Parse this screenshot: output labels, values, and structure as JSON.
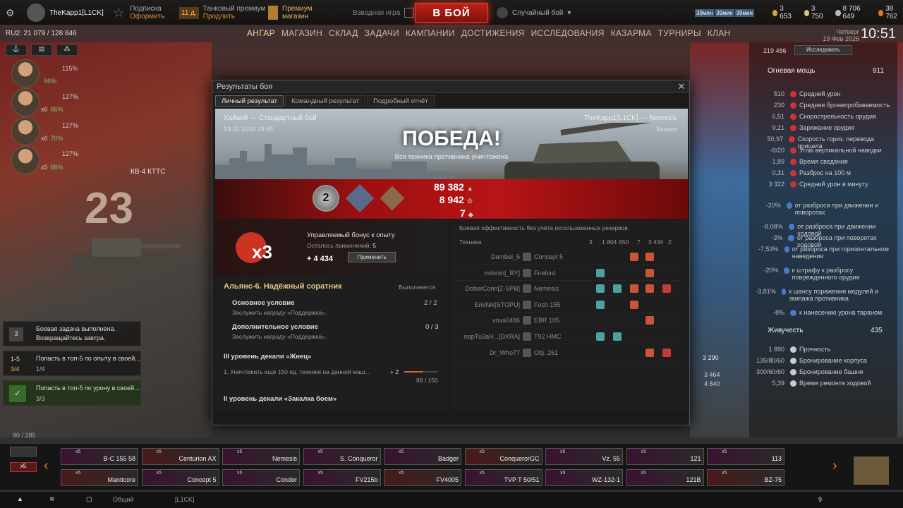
{
  "topbar": {
    "player": "TheKapp1[L1CK]",
    "sub_label": "Подписка",
    "sub_action": "Оформить",
    "prem_days": "11 д.",
    "prem_label": "Танковый премиум",
    "prem_action": "Продлить",
    "shop_line1": "Премиум",
    "shop_line2": "магазин",
    "platoon": "Взводная игра",
    "battle": "В БОЙ",
    "mode": "Случайный бой",
    "queue": [
      "39мин",
      "39мин",
      "39мин"
    ],
    "gold": "3 653",
    "bonds": "3 750",
    "credits": "8 706 649",
    "freexp": "38 762"
  },
  "nav": {
    "items": [
      "АНГАР",
      "МАГАЗИН",
      "СКЛАД",
      "ЗАДАЧИ",
      "КАМПАНИИ",
      "ДОСТИЖЕНИЯ",
      "ИССЛЕДОВАНИЯ",
      "КАЗАРМА",
      "ТУРНИРЫ",
      "КЛАН"
    ],
    "time": "10:51",
    "day": "Четверг",
    "date": "19 Фев 2026"
  },
  "ru": "RU2: 21 079  /  128 846",
  "crew": [
    {
      "mult": "",
      "pct1": "115%",
      "pct2": "66%"
    },
    {
      "mult": "x6",
      "pct1": "127%",
      "pct2": "66%"
    },
    {
      "mult": "x6",
      "pct1": "127%",
      "pct2": "70%"
    },
    {
      "mult": "x5",
      "pct1": "127%",
      "pct2": "66%"
    }
  ],
  "hangar_tank": "КВ-4 КТТС",
  "window": {
    "title": "Результаты боя",
    "tabs": [
      "Личный результат",
      "Командный результат",
      "Подробный отчёт"
    ],
    "map": "Хайвей — Стандартный бой",
    "date": "19.02.2026 10:45",
    "player": "TheKapp1[L1CK] — Nemesis",
    "survived": "Выжил",
    "victory": "ПОБЕДА!",
    "victory_sub": "Вся техника противника уничтожена",
    "credits": "89 382",
    "xp": "8 942",
    "crystals": "7",
    "mastery": "2"
  },
  "bonus": {
    "title": "Управляемый бонус к опыту",
    "remaining_label": "Осталось применений:",
    "remaining": "5",
    "xp": "+ 4 434",
    "apply": "Применить",
    "mult": "x3"
  },
  "quest": {
    "title": "Альянс-6. Надёжный соратник",
    "status": "Выполняется",
    "main_label": "Основное условие",
    "main_desc": "Заслужить награду «Поддержка».",
    "main_prog": "2 / 2",
    "extra_label": "Дополнительное условие",
    "extra_desc": "Заслужить награду «Поддержка».",
    "extra_prog": "0 / 3",
    "decal1": "III уровень декали «Жнец»",
    "decal1_task": "1. Уничтожить ещё 150 ед. техники на данной маш...",
    "decal1_plus": "+ 2",
    "decal1_prog": "86 / 150",
    "decal2": "II уровень декали «Закалка боем»"
  },
  "eff": {
    "title": "Боевая эффективность без учёта использованных резервов",
    "col_tech": "Техника",
    "cols": [
      "3",
      "1 804",
      "650",
      "7",
      "3 434",
      "2"
    ],
    "rows": [
      {
        "p": "Dembel_5",
        "v": "Concept 5"
      },
      {
        "p": "milonin[_BY]",
        "v": "Firebird"
      },
      {
        "p": "DoberConn[Z-SPB]",
        "v": "Nemesis"
      },
      {
        "p": "EmiNik[STOPU]",
        "v": "Foch 155"
      },
      {
        "p": "vova0486",
        "v": "EBR 105"
      },
      {
        "p": "napTu3aH...[DXRA]",
        "v": "T92 HMC"
      },
      {
        "p": "Dr_Who77",
        "v": "Obj. 261"
      }
    ]
  },
  "right": {
    "research_xp": "219 486",
    "research": "Исследовать",
    "firepower": "Огневая мощь",
    "firepower_val": "911",
    "fp_rows": [
      {
        "n": "510",
        "t": "Средний урон"
      },
      {
        "n": "230",
        "t": "Средняя бронепробиваемость"
      },
      {
        "n": "6,51",
        "t": "Скорострельность орудия"
      },
      {
        "n": "9,21",
        "t": "Заряжание орудия"
      },
      {
        "n": "50,97",
        "t": "Скорость гориз. перевода прицела"
      },
      {
        "n": "-8/20",
        "t": "Углы вертикальной наводки"
      },
      {
        "n": "1,89",
        "t": "Время сведения"
      },
      {
        "n": "0,31",
        "t": "Разброс на 100 м"
      },
      {
        "n": "3 322",
        "t": "Средний урон в минуту"
      }
    ],
    "disp_rows": [
      {
        "n": "-20%",
        "t": "от разброса при движении и поворотах"
      },
      {
        "n": "-8,08%",
        "t": "от разброса при движении ходовой"
      },
      {
        "n": "-3%",
        "t": "от разброса при поворотах ходовой"
      },
      {
        "n": "-7,53%",
        "t": "от разброса при горизонтальном наведении"
      },
      {
        "n": "-20%",
        "t": "к штрафу к разбросу поврежденного орудия"
      },
      {
        "n": "-3,81%",
        "t": "к шансу поражения модулей и экипажа противника"
      },
      {
        "n": "-8%",
        "t": "к нанесению урона тараном"
      }
    ],
    "surv": "Живучесть",
    "surv_val": "435",
    "sv_rows": [
      {
        "n": "1 890",
        "t": "Прочность"
      },
      {
        "n": "135/80/60",
        "t": "Бронирование корпуса"
      },
      {
        "n": "300/60/60",
        "t": "Бронирование башни"
      },
      {
        "n": "5,39",
        "t": "Время ремонта ходовой"
      }
    ],
    "side_nums": [
      "3 290",
      "3 464",
      "4 840"
    ]
  },
  "left_quests": [
    {
      "title": "Боевая задача выполнена.",
      "sub": "Возвращайтесь завтра."
    },
    {
      "title": "Попасть в топ-5 по опыту в своей...",
      "prog": "1/4",
      "left": "1-5",
      "left2": "3/4"
    },
    {
      "title": "Попасть в топ-5 по урону в своей...",
      "prog": "3/3"
    }
  ],
  "garage": "90 / 285",
  "carousel": [
    "В-С 155 58",
    "Centurion AX",
    "Nemesis",
    "S. Conqueror",
    "Badger",
    "ConquerorGC",
    "Vz. 55",
    "121",
    "113",
    "Manticore",
    "Concept 5",
    "Condor",
    "FV215b",
    "FV4005",
    "TVP T 50/51",
    "WZ-132-1",
    "121B",
    "BZ-75"
  ],
  "bottombar": {
    "chat": "Общий",
    "clan": "[L1CK]",
    "count": "9"
  }
}
